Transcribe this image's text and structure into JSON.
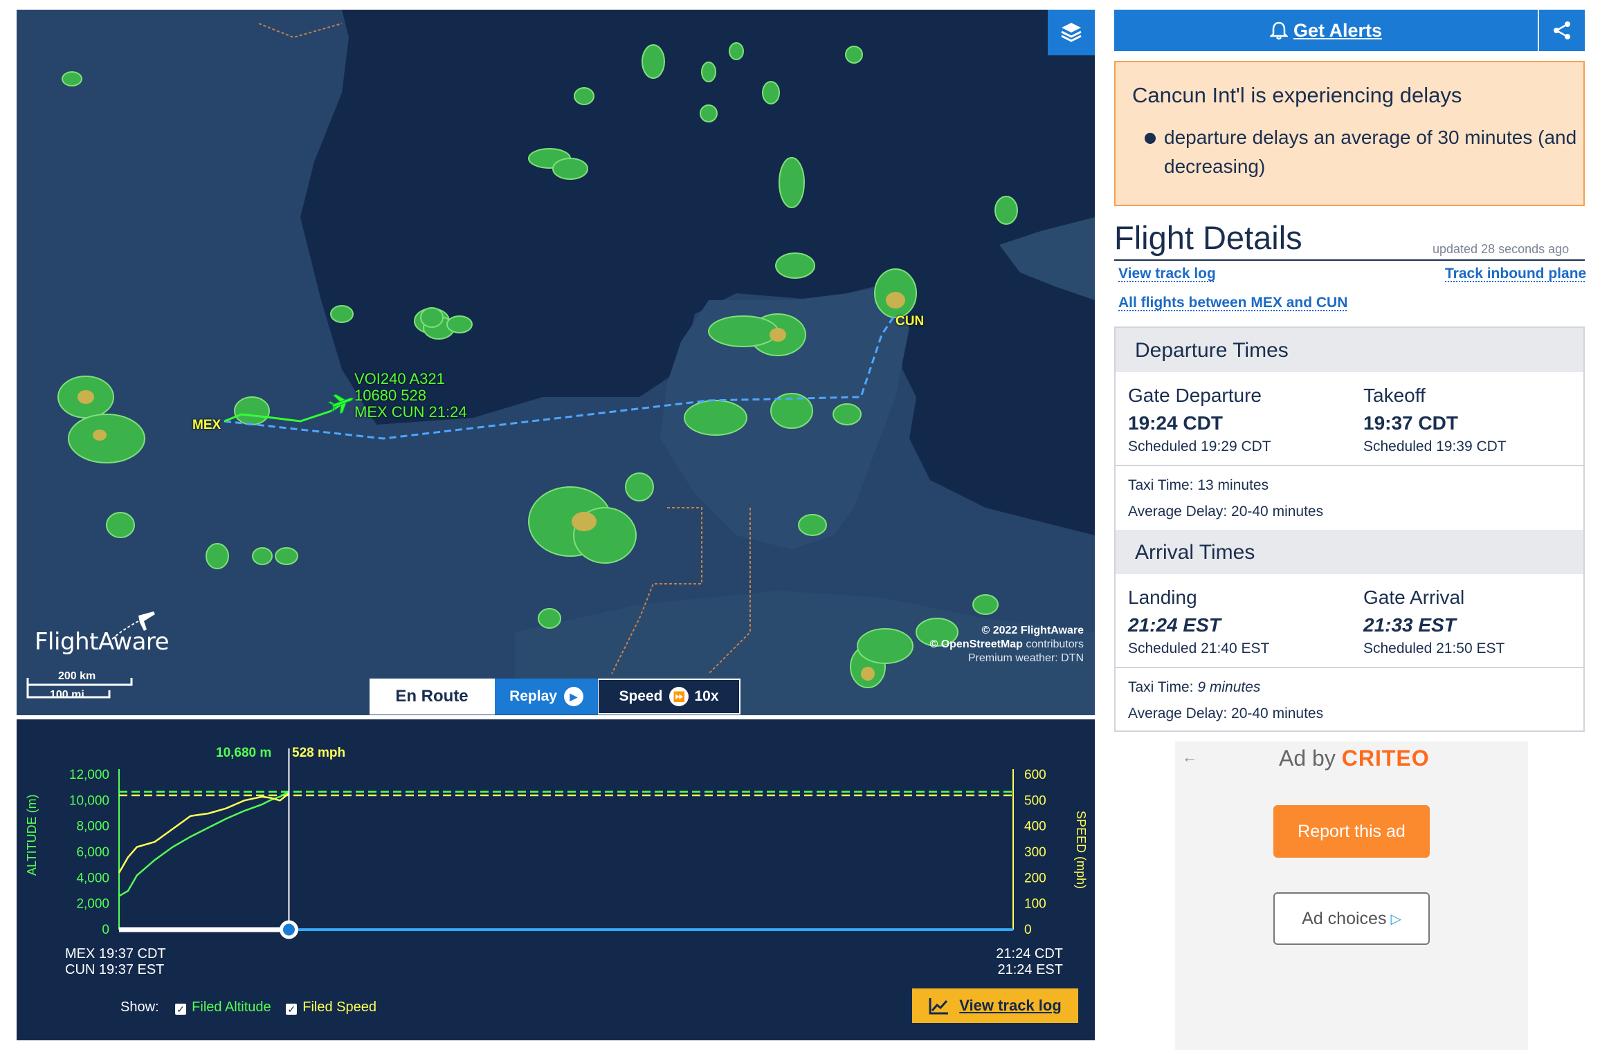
{
  "map": {
    "airports": {
      "origin": "MEX",
      "destination": "CUN"
    },
    "flight_label": {
      "line1": "VOI240 A321",
      "line2": "10680 528",
      "line3": "MEX CUN 21:24"
    },
    "logo": "FlightAware",
    "scale": {
      "km": "200 km",
      "mi": "100 mi"
    },
    "copyright": {
      "line1": "© 2022 FlightAware",
      "line2_bold": "© OpenStreetMap",
      "line2_rest": " contributors",
      "line3": "Premium weather: DTN"
    },
    "layers_icon": "layers-icon",
    "tabs": {
      "en_route": "En Route",
      "replay": "Replay",
      "speed": "Speed",
      "speed_value": "10x"
    }
  },
  "chart": {
    "current_altitude": "10,680 m",
    "current_speed": "528 mph",
    "altitude_axis_label": "ALTITUDE (m)",
    "speed_axis_label": "SPEED (mph)",
    "altitude_ticks": [
      "12,000",
      "10,000",
      "8,000",
      "6,000",
      "4,000",
      "2,000",
      "0"
    ],
    "speed_ticks": [
      "600",
      "500",
      "400",
      "300",
      "200",
      "100",
      "0"
    ],
    "start_time_line1": "MEX 19:37 CDT",
    "start_time_line2": "CUN 19:37 EST",
    "end_time_line1": "21:24 CDT",
    "end_time_line2": "21:24 EST",
    "show_label": "Show:",
    "filed_altitude": "Filed Altitude",
    "filed_speed": "Filed Speed",
    "view_track_log": "View track log",
    "progress": 0.19,
    "colors": {
      "altitude": "#55ff55",
      "speed": "#ffff55",
      "background": "#13294b"
    }
  },
  "chart_data": {
    "type": "line",
    "xlabel": "",
    "ylabel": "ALTITUDE (m)",
    "ylim": [
      0,
      12000
    ],
    "y2label": "SPEED (mph)",
    "y2lim": [
      0,
      600
    ],
    "x": [
      0,
      0.01,
      0.02,
      0.04,
      0.06,
      0.08,
      0.1,
      0.12,
      0.14,
      0.16,
      0.17,
      0.18,
      0.19
    ],
    "series": [
      {
        "name": "Filed Altitude",
        "axis": "left",
        "values": [
          2600,
          3000,
          4200,
          5400,
          6400,
          7200,
          7900,
          8600,
          9200,
          9700,
          10050,
          10300,
          10680
        ],
        "filed": 10680
      },
      {
        "name": "Filed Speed",
        "axis": "right",
        "values": [
          220,
          280,
          320,
          340,
          390,
          440,
          450,
          470,
          500,
          515,
          510,
          500,
          528
        ],
        "filed": 520
      }
    ]
  },
  "sidebar": {
    "get_alerts": "Get Alerts",
    "bell_icon": "bell-icon",
    "share_icon": "share-icon",
    "delay_title": "Cancun Int'l is experiencing delays",
    "delay_item": "departure delays an average of 30 minutes (and decreasing)",
    "flight_details_title": "Flight Details",
    "updated": "updated 28 seconds ago",
    "view_track_log": "View track log",
    "track_inbound": "Track inbound plane",
    "all_flights": "All flights between MEX and CUN",
    "departure": {
      "header": "Departure Times",
      "gate_label": "Gate Departure",
      "gate_time": "19:24 CDT",
      "gate_sched": "Scheduled 19:29 CDT",
      "takeoff_label": "Takeoff",
      "takeoff_time": "19:37 CDT",
      "takeoff_sched": "Scheduled 19:39 CDT",
      "taxi": "Taxi Time: 13 minutes",
      "avg_delay": "Average Delay: 20-40 minutes"
    },
    "arrival": {
      "header": "Arrival Times",
      "landing_label": "Landing",
      "landing_time": "21:24 EST",
      "landing_sched": "Scheduled 21:40 EST",
      "gate_label": "Gate Arrival",
      "gate_time": "21:33 EST",
      "gate_sched": "Scheduled 21:50 EST",
      "taxi_prefix": "Taxi Time: ",
      "taxi_value": "9 minutes",
      "avg_delay": "Average Delay: 20-40 minutes"
    }
  },
  "ad": {
    "ad_by": "Ad by",
    "brand": "CRITEO",
    "report": "Report this ad",
    "choices": "Ad choices"
  }
}
